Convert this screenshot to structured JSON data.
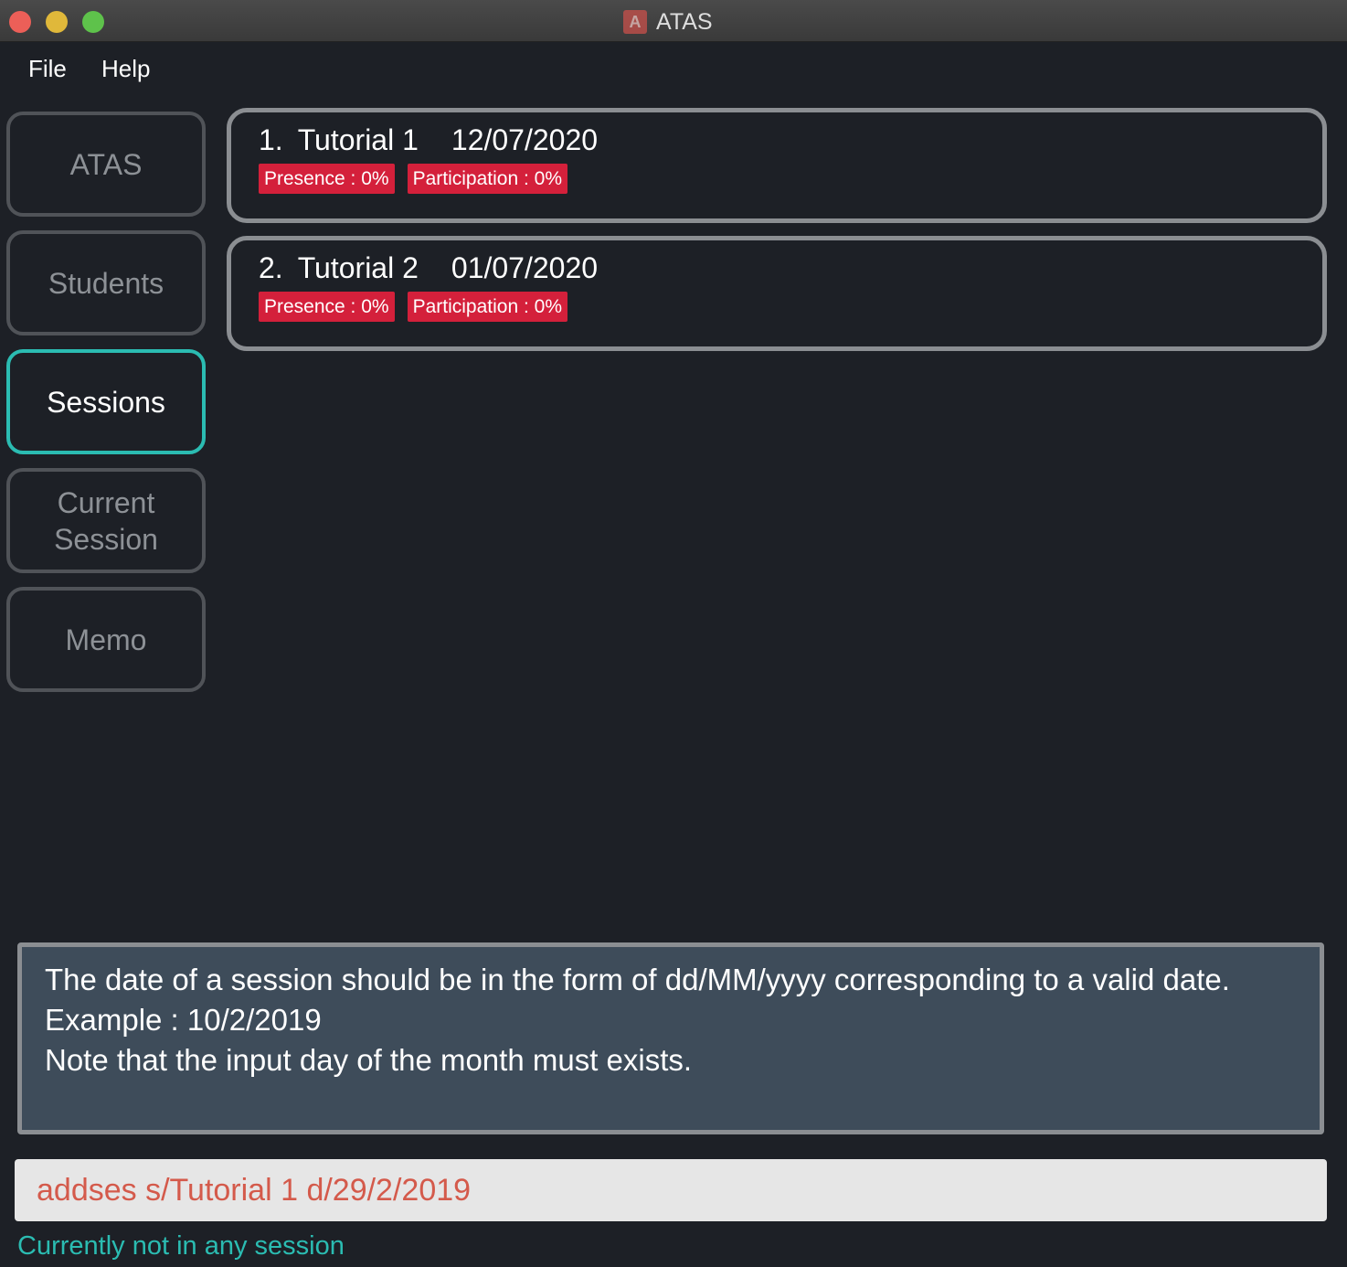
{
  "window": {
    "title": "ATAS",
    "icon_letter": "A"
  },
  "menu": {
    "file": "File",
    "help": "Help"
  },
  "sidebar": {
    "items": [
      {
        "label": "ATAS"
      },
      {
        "label": "Students"
      },
      {
        "label": "Sessions",
        "active": true
      },
      {
        "label_line1": "Current",
        "label_line2": "Session"
      },
      {
        "label": "Memo"
      }
    ]
  },
  "sessions": [
    {
      "index": "1.",
      "name": "Tutorial 1",
      "date": "12/07/2020",
      "presence": "Presence : 0%",
      "participation": "Participation : 0%"
    },
    {
      "index": "2.",
      "name": "Tutorial 2",
      "date": "01/07/2020",
      "presence": "Presence : 0%",
      "participation": "Participation : 0%"
    }
  ],
  "result": {
    "line1": "The date of a session should be in the form of dd/MM/yyyy corresponding to a valid date.",
    "line2": "Example : 10/2/2019",
    "line3": "Note that the input day of the month must exists."
  },
  "command": {
    "value": "addses s/Tutorial 1 d/29/2/2019"
  },
  "status": {
    "text": "Currently not in any session"
  },
  "colors": {
    "background": "#1d2026",
    "accent": "#2bbcb2",
    "badge": "#d4203b",
    "command_text": "#d45a4b",
    "result_bg": "#3e4c5a"
  }
}
